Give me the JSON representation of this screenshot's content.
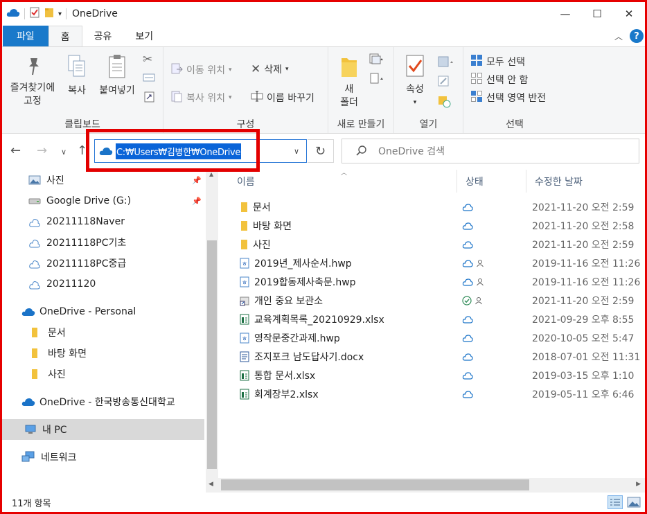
{
  "window": {
    "title": "OneDrive",
    "minimize": "—",
    "maximize": "☐",
    "close": "✕",
    "qa_dropdown": "▾"
  },
  "tabs": [
    "파일",
    "홈",
    "공유",
    "보기"
  ],
  "ribbon": {
    "clipboard": {
      "label": "클립보드",
      "pin_line1": "즐겨찾기에",
      "pin_line2": "고정",
      "copy": "복사",
      "paste": "붙여넣기"
    },
    "organize": {
      "label": "구성",
      "move_to": "이동 위치",
      "copy_to": "복사 위치",
      "delete": "삭제",
      "rename": "이름 바꾸기"
    },
    "new": {
      "label": "새로 만들기",
      "folder_line1": "새",
      "folder_line2": "폴더"
    },
    "open": {
      "label": "열기",
      "properties": "속성"
    },
    "select": {
      "label": "선택",
      "select_all": "모두 선택",
      "select_none": "선택 안 함",
      "invert": "선택 영역 반전"
    }
  },
  "address": {
    "path": "C:₩Users₩김병한₩OneDrive"
  },
  "search": {
    "placeholder": "OneDrive 검색"
  },
  "sidebar": {
    "items": [
      "사진",
      "Google Drive (G:)",
      "20211118Naver",
      "20211118PC기초",
      "20211118PC중급",
      "20211120",
      "OneDrive - Personal",
      "문서",
      "바탕 화면",
      "사진",
      "OneDrive - 한국방송통신대학교",
      "내 PC",
      "네트워크"
    ]
  },
  "columns": {
    "name": "이름",
    "status": "상태",
    "modified": "수정한 날짜"
  },
  "files": [
    {
      "name": "문서",
      "date": "2021-11-20 오전 2:59"
    },
    {
      "name": "바탕 화면",
      "date": "2021-11-20 오전 2:58"
    },
    {
      "name": "사진",
      "date": "2021-11-20 오전 2:59"
    },
    {
      "name": "2019년_제사순서.hwp",
      "date": "2019-11-16 오전 11:26"
    },
    {
      "name": "2019합동제사축문.hwp",
      "date": "2019-11-16 오전 11:26"
    },
    {
      "name": "개인 중요 보관소",
      "date": "2021-11-20 오전 2:59"
    },
    {
      "name": "교육계획목록_20210929.xlsx",
      "date": "2021-09-29 오후 8:55"
    },
    {
      "name": "영작문중간과제.hwp",
      "date": "2020-10-05 오전 5:47"
    },
    {
      "name": "조지포크 남도답사기.docx",
      "date": "2018-07-01 오전 11:31"
    },
    {
      "name": "통합 문서.xlsx",
      "date": "2019-03-15 오후 1:10"
    },
    {
      "name": "회계장부2.xlsx",
      "date": "2019-05-11 오후 6:46"
    }
  ],
  "status": {
    "count": "11개 항목"
  },
  "colors": {
    "accent": "#1979ca",
    "highlight": "#e30000",
    "selection": "#0a64d8",
    "cloud": "#1a73c8",
    "synced": "#2e8b57"
  }
}
